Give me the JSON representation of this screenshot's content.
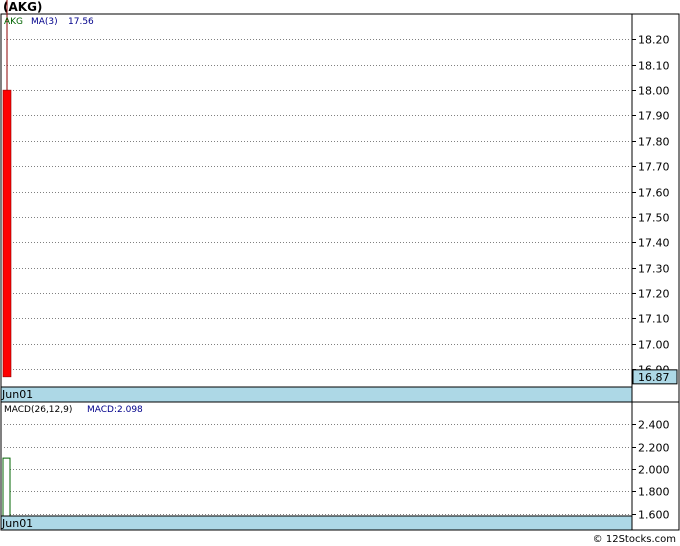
{
  "ticker_title": "(AKG)",
  "credit": "© 12Stocks.com",
  "colors": {
    "background": "#ffffff",
    "date_band": "#add8e6",
    "candle_down": "#ff0000",
    "wick": "#8b0000",
    "macd_bar": "#006400",
    "legend_ticker": "#006400",
    "legend_ma": "#00008b",
    "grid": "#808080"
  },
  "chart_data": [
    {
      "type": "candlestick",
      "title": "",
      "legend": {
        "ticker": "AKG",
        "ma_label": "MA(3)",
        "ma_value": "17.56"
      },
      "x_labels": [
        "Jun01"
      ],
      "ylim": [
        16.83,
        18.3
      ],
      "y_ticks": [
        "18.20",
        "18.10",
        "18.00",
        "17.90",
        "17.80",
        "17.70",
        "17.60",
        "17.50",
        "17.40",
        "17.30",
        "17.20",
        "17.10",
        "17.00",
        "16.90"
      ],
      "last_price_label": "16.87",
      "candles": [
        {
          "date": "Jun01",
          "open": 18.0,
          "high": 18.54,
          "low": 16.87,
          "close": 16.87
        }
      ]
    },
    {
      "type": "bar",
      "title": "",
      "legend": {
        "label": "MACD(26,12,9)",
        "value_label": "MACD:2.098"
      },
      "x_labels": [
        "Jun01"
      ],
      "ylim": [
        1.58,
        2.6
      ],
      "y_ticks": [
        "2.400",
        "2.200",
        "2.000",
        "1.800",
        "1.600"
      ],
      "values": [
        2.098
      ]
    }
  ]
}
